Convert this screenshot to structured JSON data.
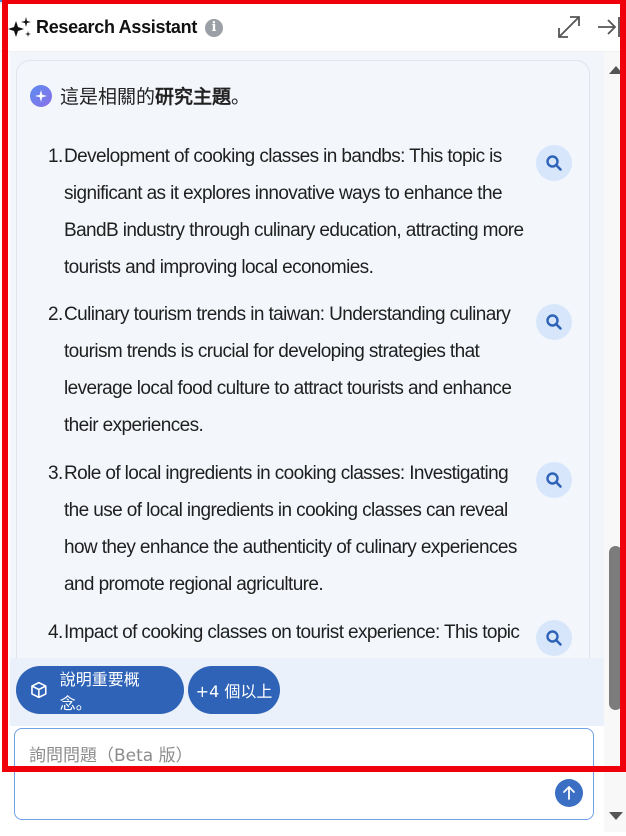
{
  "header": {
    "title": "Research Assistant",
    "info": "i"
  },
  "intro": {
    "prefix": "這是相關的",
    "bold": "研究主題",
    "suffix": "。"
  },
  "topics": [
    {
      "num": "1.",
      "text": "Development of cooking classes in bandbs: This topic is significant as it explores innovative ways to enhance the BandB industry through culinary education, attracting more tourists and improving local economies."
    },
    {
      "num": "2.",
      "text": "Culinary tourism trends in taiwan: Understanding culinary tourism trends is crucial for developing strategies that leverage local food culture to attract tourists and enhance their experiences."
    },
    {
      "num": "3.",
      "text": "Role of local ingredients in cooking classes: Investigating the use of local ingredients in cooking classes can reveal how they enhance the authenticity of culinary experiences and promote regional agriculture."
    },
    {
      "num": "4.",
      "text": "Impact of cooking classes on tourist experience: This topic is"
    }
  ],
  "chips": {
    "explain": "說明重要概念。",
    "more": "+4 個以上"
  },
  "input": {
    "placeholder": "詢問問題（Beta 版）"
  }
}
